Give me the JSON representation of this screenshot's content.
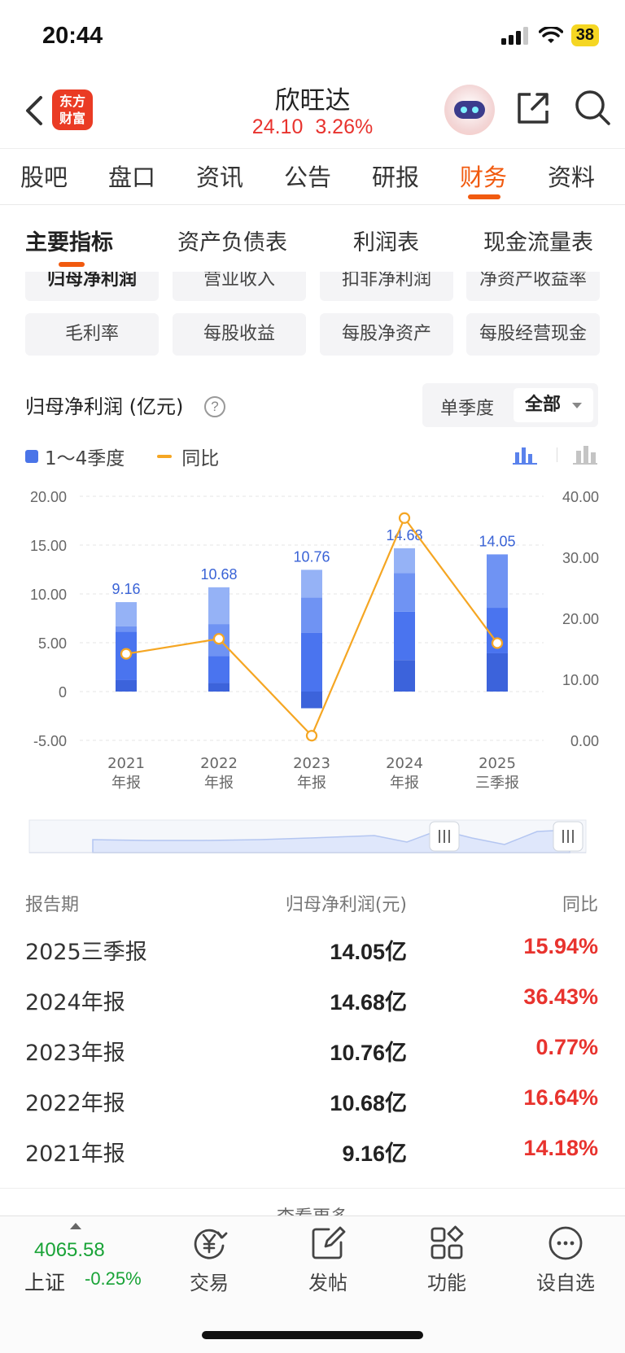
{
  "status": {
    "time": "20:44",
    "battery": "38"
  },
  "header": {
    "logo_line1": "东方",
    "logo_line2": "财富",
    "stock_name": "欣旺达",
    "price": "24.10",
    "change_pct": "3.26%"
  },
  "tabs": [
    "股吧",
    "盘口",
    "资讯",
    "公告",
    "研报",
    "财务",
    "资料"
  ],
  "active_tab": "财务",
  "subtabs": [
    "主要指标",
    "资产负债表",
    "利润表",
    "现金流量表"
  ],
  "metrics_row1": [
    "归母净利润",
    "营业收入",
    "扣非净利润",
    "净资产收益率"
  ],
  "metrics_row2": [
    "毛利率",
    "每股收益",
    "每股净资产",
    "每股经营现金"
  ],
  "chart_header": {
    "title": "归母净利润 (亿元)",
    "help": "?",
    "period_single": "单季度",
    "period_all": "全部"
  },
  "legend": {
    "bars": "1～4季度",
    "line": "同比"
  },
  "chart_data": {
    "type": "bar",
    "categories": [
      [
        "2021",
        "年报"
      ],
      [
        "2022",
        "年报"
      ],
      [
        "2023",
        "年报"
      ],
      [
        "2024",
        "年报"
      ],
      [
        "2025",
        "三季报"
      ]
    ],
    "y_left_ticks": [
      "20.00",
      "15.00",
      "10.00",
      "5.00",
      "0",
      "-5.00"
    ],
    "y_left_range": [
      -5,
      20
    ],
    "y_right_ticks": [
      "40.00",
      "30.00",
      "20.00",
      "10.00",
      "0.00"
    ],
    "y_right_range": [
      0,
      40
    ],
    "quarter_stacks": [
      [
        1.17,
        4.95,
        0.55,
        2.49
      ],
      [
        0.88,
        2.75,
        3.28,
        3.77
      ],
      [
        -1.71,
        6.03,
        3.59,
        2.85
      ],
      [
        3.23,
        4.95,
        3.95,
        2.55
      ],
      [
        3.92,
        4.66,
        5.47
      ]
    ],
    "totals": [
      9.16,
      10.68,
      10.76,
      14.68,
      14.05
    ],
    "total_labels": [
      "9.16",
      "10.68",
      "10.76",
      "14.68",
      "14.05"
    ],
    "yoy": [
      14.18,
      16.64,
      0.77,
      36.43,
      15.94
    ],
    "colors": {
      "q1": "#3c63db",
      "q2": "#4a74ef",
      "q3": "#6f93f3",
      "q4": "#95b2f6",
      "line": "#f5a623",
      "label": "#3a63d6"
    }
  },
  "table": {
    "headers": {
      "period": "报告期",
      "value": "归母净利润(元)",
      "yoy": "同比"
    },
    "rows": [
      {
        "period": "2025三季报",
        "value": "14.05",
        "unit": "亿",
        "yoy": "15.94%"
      },
      {
        "period": "2024年报",
        "value": "14.68",
        "unit": "亿",
        "yoy": "36.43%"
      },
      {
        "period": "2023年报",
        "value": "10.76",
        "unit": "亿",
        "yoy": "0.77%"
      },
      {
        "period": "2022年报",
        "value": "10.68",
        "unit": "亿",
        "yoy": "16.64%"
      },
      {
        "period": "2021年报",
        "value": "9.16",
        "unit": "亿",
        "yoy": "14.18%"
      }
    ],
    "more": "查看更多"
  },
  "bottom": {
    "index_value": "4065.58",
    "index_name": "上证",
    "index_change": "-0.25%",
    "nav": [
      "交易",
      "发帖",
      "功能",
      "设自选"
    ]
  }
}
